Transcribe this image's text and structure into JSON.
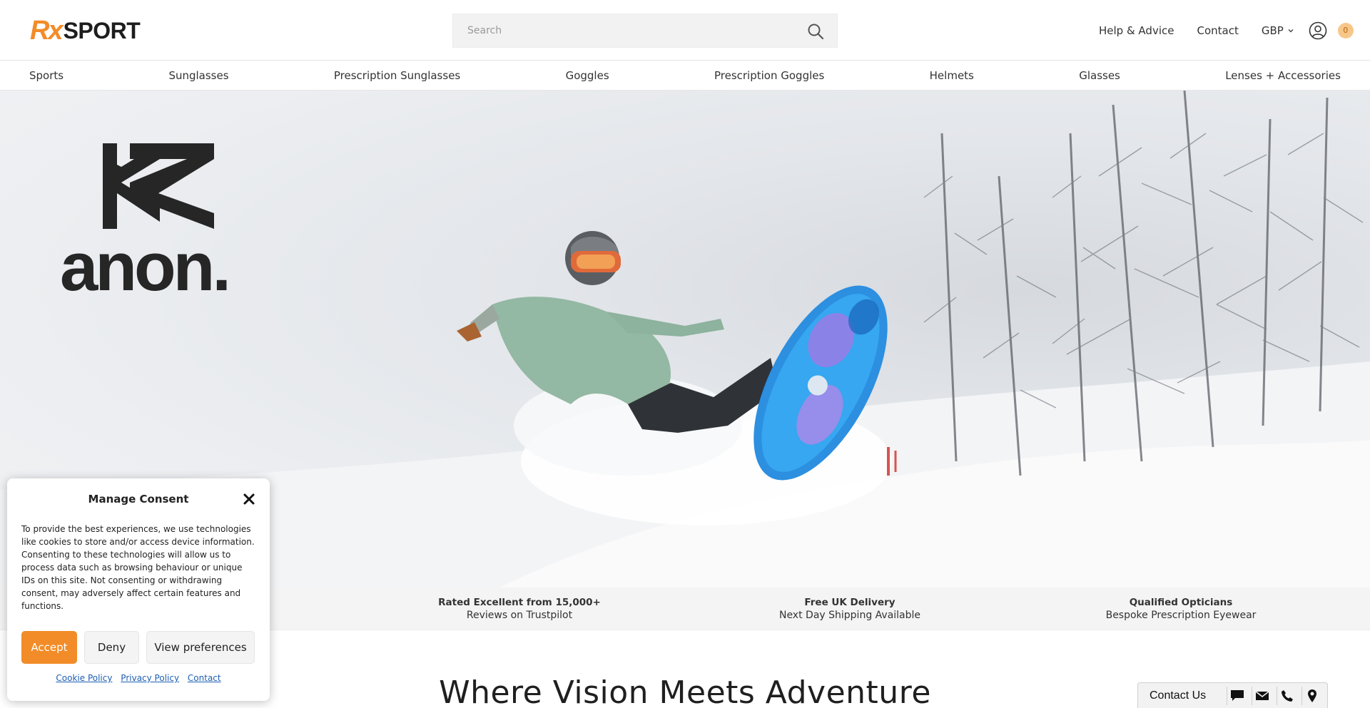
{
  "header": {
    "logo_rx": "Rx",
    "logo_sport": "SPORT",
    "search_placeholder": "Search",
    "links": {
      "help": "Help & Advice",
      "contact": "Contact"
    },
    "currency": "GBP",
    "cart_count": "0"
  },
  "nav": {
    "items": [
      {
        "label": "Sports"
      },
      {
        "label": "Sunglasses"
      },
      {
        "label": "Prescription Sunglasses"
      },
      {
        "label": "Goggles"
      },
      {
        "label": "Prescription Goggles"
      },
      {
        "label": "Helmets"
      },
      {
        "label": "Glasses"
      },
      {
        "label": "Lenses + Accessories"
      }
    ]
  },
  "hero": {
    "brand": "anon."
  },
  "usp": {
    "items": [
      {
        "title": "Rated Excellent from 15,000+",
        "subtitle": "Reviews on Trustpilot"
      },
      {
        "title": "Free UK Delivery",
        "subtitle": "Next Day Shipping Available"
      },
      {
        "title": "Qualified Opticians",
        "subtitle": "Bespoke Prescription Eyewear"
      }
    ]
  },
  "main": {
    "section_title": "Where Vision Meets Adventure"
  },
  "consent": {
    "title": "Manage Consent",
    "body": "To provide the best experiences, we use technologies like cookies to store and/or access device information. Consenting to these technologies will allow us to process data such as browsing behaviour or unique IDs on this site. Not consenting or withdrawing consent, may adversely affect certain features and functions.",
    "accept": "Accept",
    "deny": "Deny",
    "preferences": "View preferences",
    "links": {
      "cookie": "Cookie Policy",
      "privacy": "Privacy Policy",
      "contact": "Contact"
    }
  },
  "contact_widget": {
    "label": "Contact Us",
    "icons": [
      "chat-icon",
      "mail-icon",
      "phone-icon",
      "location-icon"
    ]
  },
  "colors": {
    "accent": "#f28c28",
    "link": "#1d5fb3",
    "cart_badge": "#f7c78a"
  }
}
